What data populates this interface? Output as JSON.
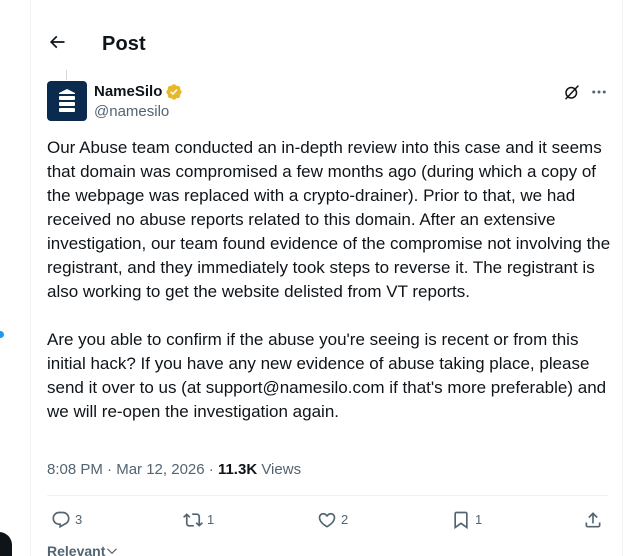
{
  "header": {
    "title": "Post",
    "back_icon": "arrow-left-icon"
  },
  "author": {
    "name": "NameSilo",
    "handle": "@namesilo",
    "verified_color": "#e8b829",
    "avatar_bg": "#0a2a4e"
  },
  "post": {
    "paragraphs": [
      "Our Abuse team conducted an in-depth review into this case and it seems that domain was compromised a few months ago (during which a copy of the webpage was replaced with a crypto-drainer). Prior to that, we had received no abuse reports related to this domain. After an extensive investigation, our team found evidence of the compromise not involving the registrant, and they immediately took steps to reverse it. The registrant is also working to get the website delisted from VT reports.",
      "Are you able to confirm if the abuse you're seeing is recent or from this initial hack? If you have any new evidence of abuse taking place, please send it over to us (at support@namesilo.com if that's more preferable) and we will re-open the investigation again."
    ]
  },
  "meta": {
    "time": "8:08 PM",
    "separator": "·",
    "date": "Mar 12, 2026",
    "views_count": "11.3K",
    "views_label": "Views"
  },
  "actions": {
    "replies": "3",
    "reposts": "1",
    "likes": "2",
    "bookmarks": "1"
  },
  "sort": {
    "label": "Relevant"
  },
  "colors": {
    "text": "#0f1419",
    "muted": "#536471",
    "border": "#eff3f4",
    "accent": "#1d9bf0"
  }
}
